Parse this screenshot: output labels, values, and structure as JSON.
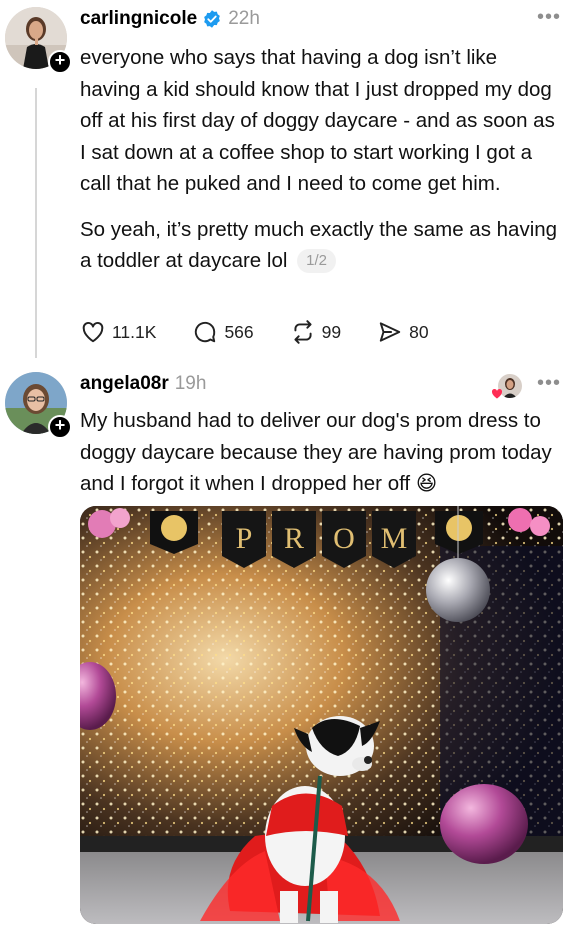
{
  "posts": [
    {
      "username": "carlingnicole",
      "verified": true,
      "time": "22h",
      "paragraphs": [
        "everyone who says that having a dog isn’t like having a kid should know that I just dropped my dog off at his first day of doggy daycare - and as soon as I sat down at a coffee shop to start working I got a call that he puked and I need to come get him.",
        "So yeah, it’s pretty much exactly the same as having a toddler at daycare lol"
      ],
      "pager": "1/2",
      "actions": {
        "likes": "11.1K",
        "replies": "566",
        "reposts": "99",
        "shares": "80"
      }
    },
    {
      "username": "angela08r",
      "time": "19h",
      "text": "My husband had to deliver our dog's prom dress to doggy daycare because they are having prom today and I forgot it when I dropped her off",
      "emoji": "😆",
      "image": {
        "banner_letters": [
          "P",
          "R",
          "O",
          "M"
        ]
      }
    }
  ],
  "icons": {
    "more": "•••",
    "follow": "+"
  },
  "colors": {
    "verified": "#1d9bf0",
    "muted": "#9a9a9a",
    "thread_line": "#d6d6d6"
  }
}
